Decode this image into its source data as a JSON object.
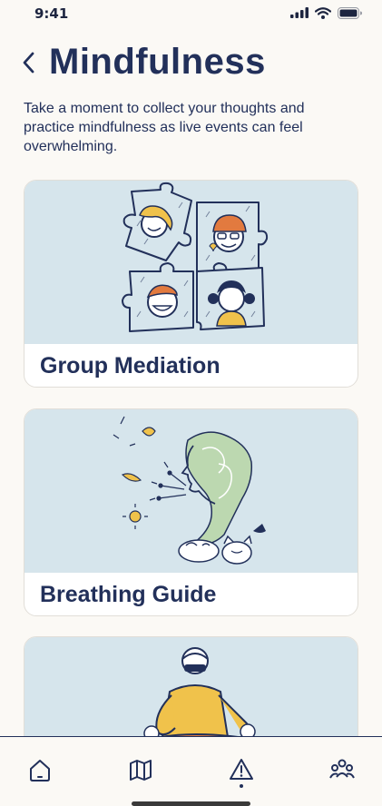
{
  "status_bar": {
    "time": "9:41"
  },
  "header": {
    "title": "Mindfulness",
    "back_icon": "chevron-left-icon"
  },
  "intro_text": "Take a moment to collect your thoughts and practice mindfulness as live events can feel overwhelming.",
  "cards": [
    {
      "title": "Group Mediation"
    },
    {
      "title": "Breathing Guide"
    },
    {
      "title": ""
    }
  ],
  "bottom_nav": [
    {
      "icon": "home-icon",
      "active": false
    },
    {
      "icon": "map-icon",
      "active": false
    },
    {
      "icon": "alert-icon",
      "active": true
    },
    {
      "icon": "community-icon",
      "active": false
    }
  ],
  "colors": {
    "background": "#fbf9f5",
    "primary": "#22305a",
    "card_illustration_bg": "#d6e5ec",
    "accent_yellow": "#f0c24b",
    "accent_orange": "#e27a3f",
    "accent_green": "#bcd8b0"
  }
}
